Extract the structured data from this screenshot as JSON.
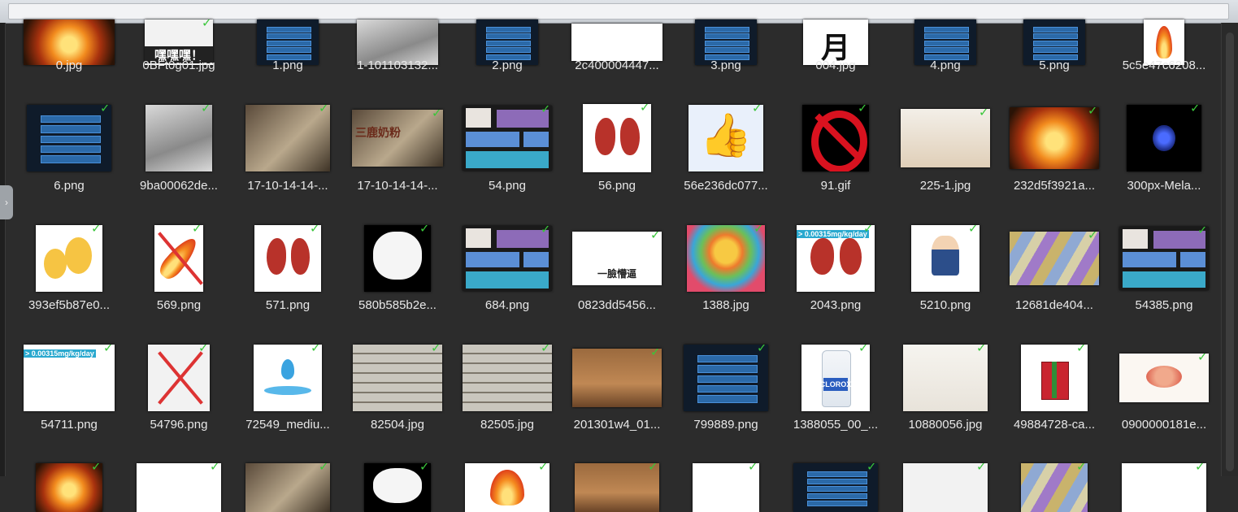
{
  "checkmark": "✓",
  "rows": [
    [
      "0.jpg",
      "0BFt0g01.jpg",
      "1.png",
      "1-101103132...",
      "2.png",
      "2c400004447...",
      "3.png",
      "004.jpg",
      "4.png",
      "5.png",
      "5c5e47c6208..."
    ],
    [
      "6.png",
      "9ba00062de...",
      "17-10-14-14-...",
      "17-10-14-14-...",
      "54.png",
      "56.png",
      "56e236dc077...",
      "91.gif",
      "225-1.jpg",
      "232d5f3921a...",
      "300px-Mela..."
    ],
    [
      "393ef5b87e0...",
      "569.png",
      "571.png",
      "580b585b2e...",
      "684.png",
      "0823dd5456...",
      "1388.jpg",
      "2043.png",
      "5210.png",
      "12681de404...",
      "54385.png"
    ],
    [
      "54711.png",
      "54796.png",
      "72549_mediu...",
      "82504.jpg",
      "82505.jpg",
      "201301w4_01...",
      "799889.png",
      "1388055_00_...",
      "10880056.jpg",
      "49884728-ca...",
      "0900000181e..."
    ]
  ],
  "thumb_text": {
    "heyhey": "嘿嘿嘿！",
    "glyph_004": "月",
    "deer": "三鹿奶粉",
    "face_caption": "一臉懵逼",
    "dose": "> 0.00315mg/kg/day",
    "clorox": "CLOROX"
  }
}
